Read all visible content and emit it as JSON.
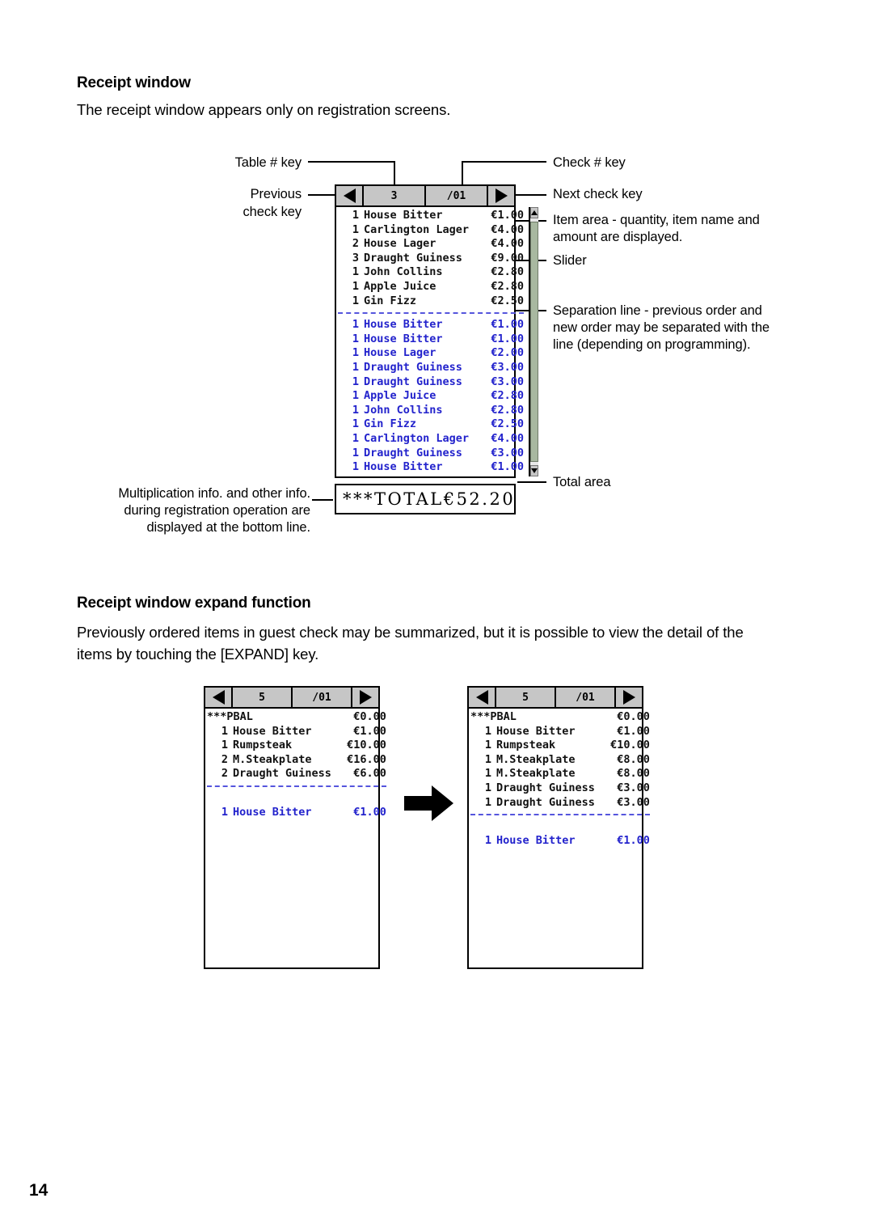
{
  "page": {
    "number": "14"
  },
  "section1": {
    "heading": "Receipt window",
    "intro": "The receipt window appears only on registration screens."
  },
  "callouts": {
    "table_key": "Table # key",
    "previous_check_key_l1": "Previous",
    "previous_check_key_l2": "check key",
    "check_key": "Check # key",
    "next_check_key": "Next check key",
    "item_area_l1": "Item area - quantity, item name and",
    "item_area_l2": "amount are displayed.",
    "slider": "Slider",
    "separation_l1": "Separation line - previous order and",
    "separation_l2": "new order may be separated with the",
    "separation_l3": "line (depending on programming).",
    "total_area": "Total area",
    "multiplication_l1": "Multiplication info. and other info.",
    "multiplication_l2": "during registration operation are",
    "multiplication_l3": "displayed at the bottom line."
  },
  "main_window": {
    "header": {
      "prev_icon": "triangle-left-icon",
      "table_no": "3",
      "check_no": "/01",
      "next_icon": "triangle-right-icon"
    },
    "previous_items": [
      {
        "qty": "1",
        "name": "House Bitter",
        "amount": "€1.00"
      },
      {
        "qty": "1",
        "name": "Carlington Lager",
        "amount": "€4.00"
      },
      {
        "qty": "2",
        "name": "House Lager",
        "amount": "€4.00"
      },
      {
        "qty": "3",
        "name": "Draught Guiness",
        "amount": "€9.00"
      },
      {
        "qty": "1",
        "name": "John Collins",
        "amount": "€2.80"
      },
      {
        "qty": "1",
        "name": "Apple Juice",
        "amount": "€2.80"
      },
      {
        "qty": "1",
        "name": "Gin Fizz",
        "amount": "€2.50"
      }
    ],
    "new_items": [
      {
        "qty": "1",
        "name": "House Bitter",
        "amount": "€1.00"
      },
      {
        "qty": "1",
        "name": "House Bitter",
        "amount": "€1.00"
      },
      {
        "qty": "1",
        "name": "House Lager",
        "amount": "€2.00"
      },
      {
        "qty": "1",
        "name": "Draught Guiness",
        "amount": "€3.00"
      },
      {
        "qty": "1",
        "name": "Draught Guiness",
        "amount": "€3.00"
      },
      {
        "qty": "1",
        "name": "Apple Juice",
        "amount": "€2.80"
      },
      {
        "qty": "1",
        "name": "John Collins",
        "amount": "€2.80"
      },
      {
        "qty": "1",
        "name": "Gin Fizz",
        "amount": "€2.50"
      },
      {
        "qty": "1",
        "name": "Carlington Lager",
        "amount": "€4.00"
      },
      {
        "qty": "1",
        "name": "Draught Guiness",
        "amount": "€3.00"
      },
      {
        "qty": "1",
        "name": "House Bitter",
        "amount": "€1.00"
      }
    ],
    "total": {
      "label": "***TOTAL",
      "amount": "€52.20"
    }
  },
  "section2": {
    "heading": "Receipt window expand function",
    "body_l1": "Previously ordered items in guest check may be summarized, but it is possible to view the detail of the",
    "body_l2": "items by touching the [EXPAND] key."
  },
  "expand": {
    "arrow_icon": "arrow-right-icon",
    "before": {
      "header": {
        "prev_icon": "triangle-left-icon",
        "table_no": "5",
        "check_no": "/01",
        "next_icon": "triangle-right-icon"
      },
      "previous_items": [
        {
          "qty": "",
          "name": "***PBAL",
          "amount": "€0.00"
        },
        {
          "qty": "1",
          "name": "House Bitter",
          "amount": "€1.00"
        },
        {
          "qty": "1",
          "name": "Rumpsteak",
          "amount": "€10.00"
        },
        {
          "qty": "2",
          "name": "M.Steakplate",
          "amount": "€16.00"
        },
        {
          "qty": "2",
          "name": "Draught Guiness",
          "amount": "€6.00"
        }
      ],
      "new_items": [
        {
          "qty": "1",
          "name": "House Bitter",
          "amount": "€1.00"
        }
      ]
    },
    "after": {
      "header": {
        "prev_icon": "triangle-left-icon",
        "table_no": "5",
        "check_no": "/01",
        "next_icon": "triangle-right-icon"
      },
      "previous_items": [
        {
          "qty": "",
          "name": "***PBAL",
          "amount": "€0.00"
        },
        {
          "qty": "1",
          "name": "House Bitter",
          "amount": "€1.00"
        },
        {
          "qty": "1",
          "name": "Rumpsteak",
          "amount": "€10.00"
        },
        {
          "qty": "1",
          "name": "M.Steakplate",
          "amount": "€8.00"
        },
        {
          "qty": "1",
          "name": "M.Steakplate",
          "amount": "€8.00"
        },
        {
          "qty": "1",
          "name": "Draught Guiness",
          "amount": "€3.00"
        },
        {
          "qty": "1",
          "name": "Draught Guiness",
          "amount": "€3.00"
        }
      ],
      "new_items": [
        {
          "qty": "1",
          "name": "House Bitter",
          "amount": "€1.00"
        }
      ]
    }
  },
  "colors": {
    "new_order_blue": "#2222cc",
    "separator_blue": "#5555dd",
    "chrome_gray": "#c6c6c6",
    "slider_thumb": "#a8b8a0"
  }
}
